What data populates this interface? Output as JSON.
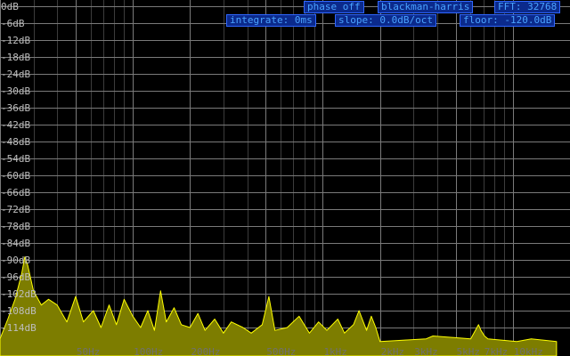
{
  "controls": {
    "phase": "phase off",
    "window": "blackman-harris",
    "fft": "FFT: 32768",
    "integrate": "integrate: 0ms",
    "slope": "slope: 0.0dB/oct",
    "floor": "floor: -120.0dB"
  },
  "db_axis": {
    "labels": [
      "0dB",
      "-6dB",
      "-12dB",
      "-18dB",
      "-24dB",
      "-30dB",
      "-36dB",
      "-42dB",
      "-48dB",
      "-54dB",
      "-60dB",
      "-66dB",
      "-72dB",
      "-78dB",
      "-84dB",
      "-90dB",
      "-96dB",
      "-102dB",
      "-108dB",
      "-114dB"
    ],
    "values": [
      0,
      -6,
      -12,
      -18,
      -24,
      -30,
      -36,
      -42,
      -48,
      -54,
      -60,
      -66,
      -72,
      -78,
      -84,
      -90,
      -96,
      -102,
      -108,
      -114
    ]
  },
  "freq_axis": {
    "labels": [
      "50Hz",
      "100Hz",
      "200Hz",
      "500Hz",
      "1kHz",
      "2kHz",
      "3kHz",
      "5kHz",
      "7kHz",
      "10kHz",
      "20kHz"
    ],
    "values": [
      50,
      100,
      200,
      500,
      1000,
      2000,
      3000,
      5000,
      7000,
      10000,
      20000
    ],
    "range": [
      20,
      20000
    ],
    "scale": "log"
  },
  "colors": {
    "background": "#000000",
    "grid_major": "#7a7a7a",
    "grid_minor": "#3c3c3c",
    "spectrum_stroke": "#ffff00",
    "spectrum_fill": "#7d7d00",
    "button_bg": "#0b2a8c",
    "button_text": "#4aa3ff"
  },
  "spectrum": {
    "db_range": [
      -120,
      0
    ],
    "peaks": [
      [
        20,
        -118
      ],
      [
        22,
        -111
      ],
      [
        24,
        -104
      ],
      [
        26,
        -95
      ],
      [
        27,
        -89
      ],
      [
        28,
        -92
      ],
      [
        30,
        -101
      ],
      [
        33,
        -106
      ],
      [
        36,
        -104
      ],
      [
        40,
        -106
      ],
      [
        45,
        -112
      ],
      [
        50,
        -103
      ],
      [
        55,
        -112
      ],
      [
        62,
        -108
      ],
      [
        68,
        -114
      ],
      [
        75,
        -106
      ],
      [
        82,
        -113
      ],
      [
        90,
        -104
      ],
      [
        100,
        -110
      ],
      [
        110,
        -114
      ],
      [
        120,
        -108
      ],
      [
        130,
        -115
      ],
      [
        140,
        -101
      ],
      [
        150,
        -112
      ],
      [
        165,
        -107
      ],
      [
        180,
        -113
      ],
      [
        200,
        -114
      ],
      [
        220,
        -109
      ],
      [
        240,
        -115
      ],
      [
        270,
        -111
      ],
      [
        300,
        -116
      ],
      [
        330,
        -112
      ],
      [
        380,
        -114
      ],
      [
        420,
        -116
      ],
      [
        480,
        -113
      ],
      [
        520,
        -103
      ],
      [
        560,
        -115
      ],
      [
        650,
        -114
      ],
      [
        750,
        -110
      ],
      [
        850,
        -116
      ],
      [
        950,
        -112
      ],
      [
        1050,
        -115
      ],
      [
        1200,
        -111
      ],
      [
        1300,
        -116
      ],
      [
        1450,
        -113
      ],
      [
        1550,
        -108
      ],
      [
        1700,
        -115
      ],
      [
        1800,
        -110
      ],
      [
        1900,
        -114
      ],
      [
        2000,
        -119
      ],
      [
        3500,
        -118
      ],
      [
        3800,
        -117
      ],
      [
        6000,
        -118
      ],
      [
        6600,
        -113
      ],
      [
        6800,
        -115
      ],
      [
        7100,
        -117
      ],
      [
        7400,
        -118
      ],
      [
        10500,
        -119
      ],
      [
        12500,
        -118
      ],
      [
        17000,
        -119
      ]
    ]
  }
}
